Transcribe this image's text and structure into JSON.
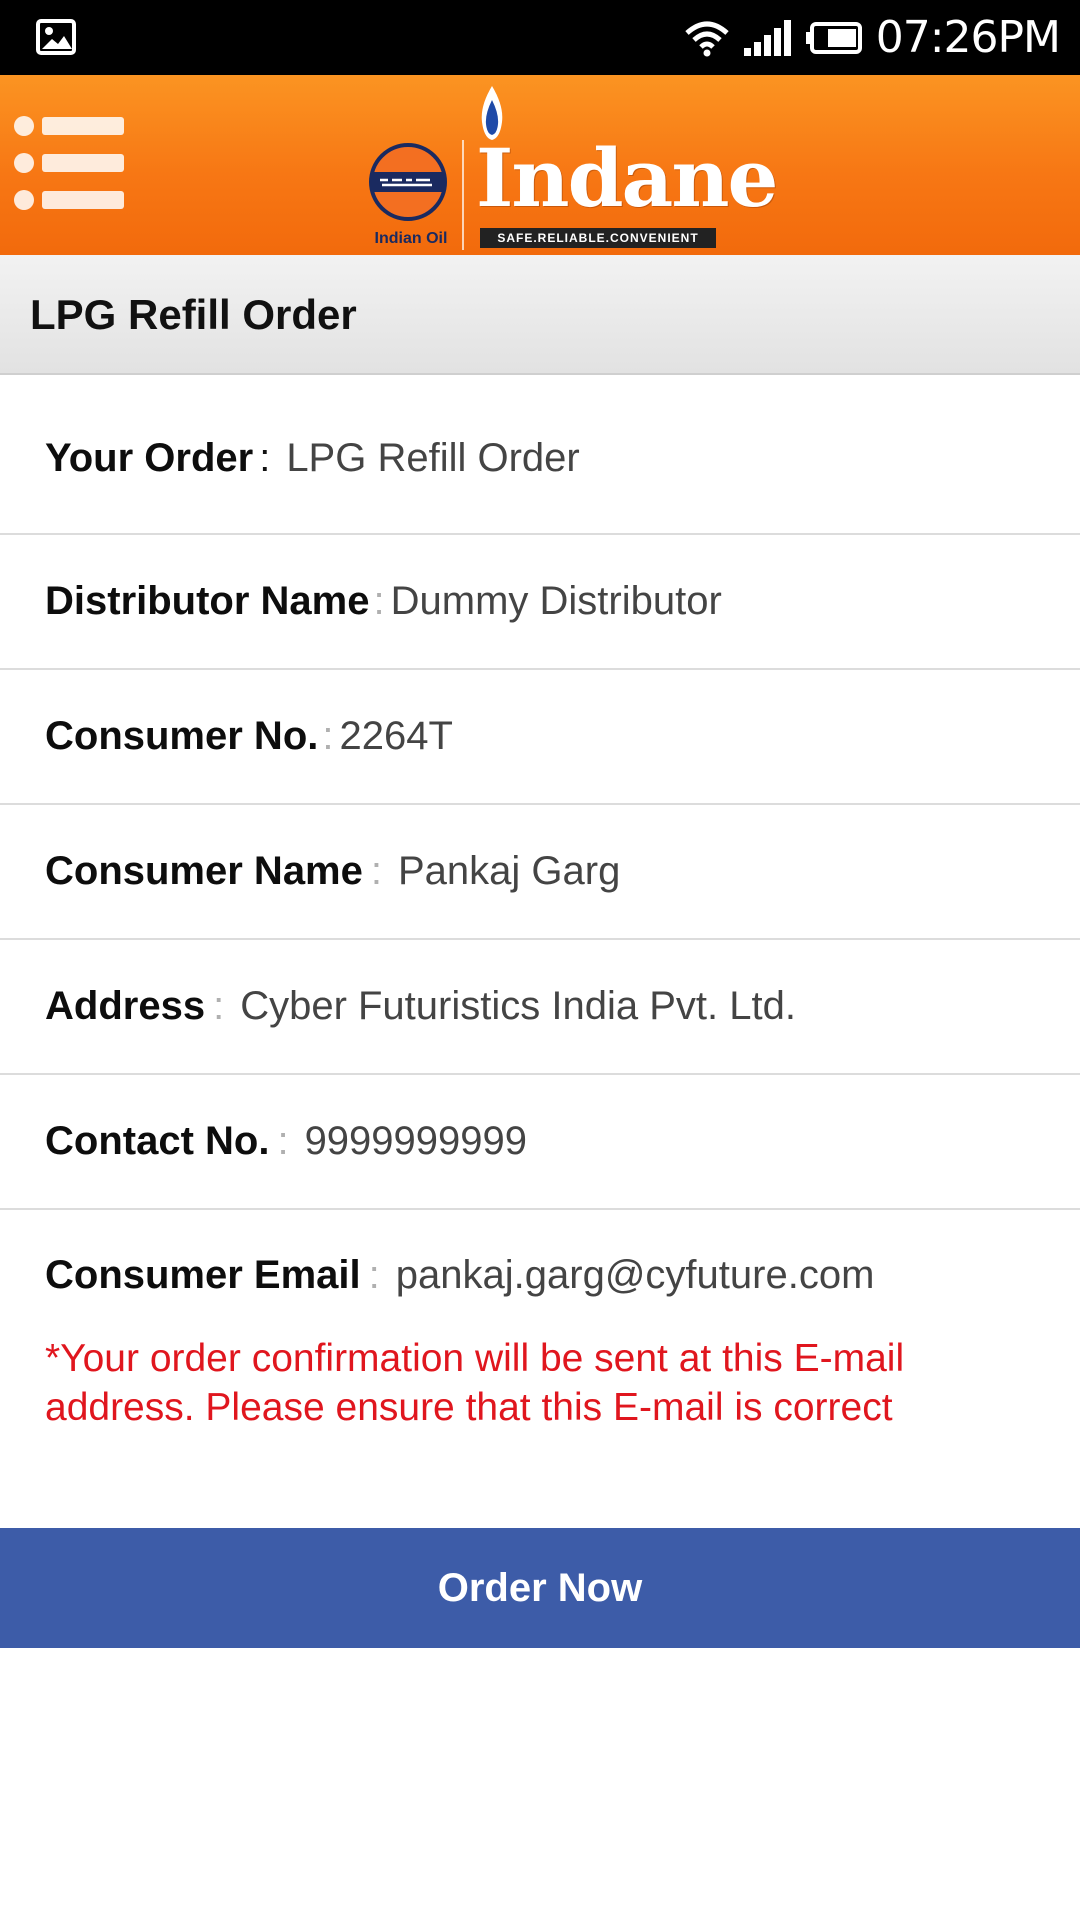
{
  "status_bar": {
    "time": "07:26PM",
    "icons": [
      "photo-icon",
      "wifi-icon",
      "signal-icon",
      "battery-icon"
    ]
  },
  "header": {
    "menu_icon": "hamburger-menu-icon",
    "brand_name": "Indane",
    "tagline": "SAFE.RELIABLE.CONVENIENT",
    "partner_logo_text": "Indian Oil",
    "colors": {
      "header_start": "#fb9422",
      "header_end": "#f26a0c"
    }
  },
  "title": "LPG Refill Order",
  "details": [
    {
      "label": "Your Order",
      "value": "LPG Refill Order"
    },
    {
      "label": "Distributor Name",
      "value": "Dummy Distributor"
    },
    {
      "label": "Consumer No.",
      "value": "2264T"
    },
    {
      "label": "Consumer Name",
      "value": "Pankaj Garg"
    },
    {
      "label": "Address",
      "value": "Cyber Futuristics India Pvt. Ltd."
    },
    {
      "label": "Contact No.",
      "value": "9999999999"
    }
  ],
  "email": {
    "label": "Consumer Email",
    "value": "pankaj.garg@cyfuture.com",
    "warning": "*Your order confirmation will be sent at this E-mail address. Please ensure that this E-mail is correct",
    "warning_color": "#e0161e"
  },
  "order_button": {
    "label": "Order Now",
    "color": "#3d5ca8"
  }
}
